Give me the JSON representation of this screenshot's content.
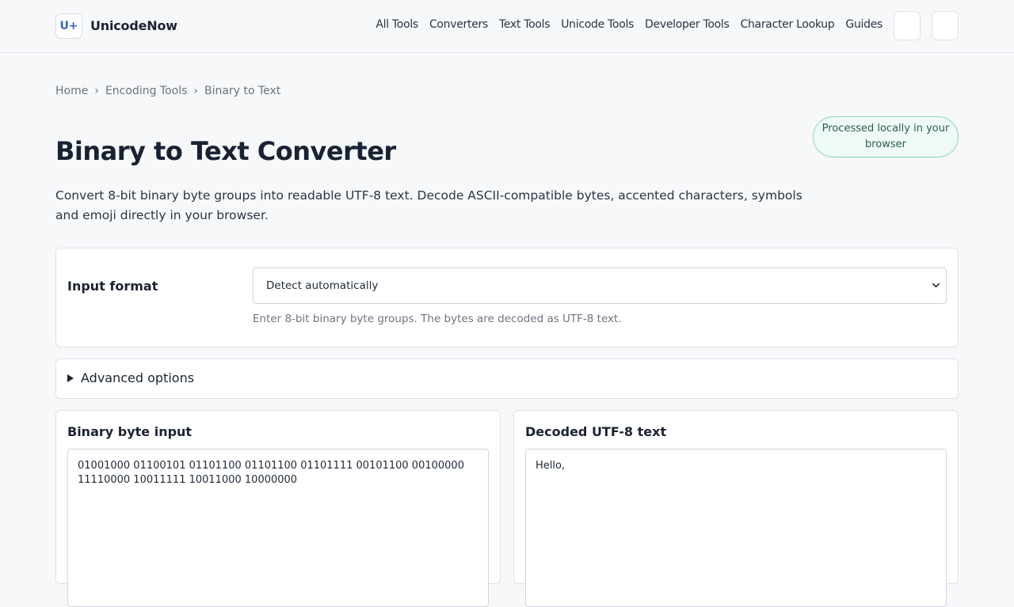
{
  "brand": {
    "logo": "U+",
    "name": "UnicodeNow"
  },
  "nav": {
    "items": [
      "All Tools",
      "Converters",
      "Text Tools",
      "Unicode Tools",
      "Developer Tools",
      "Character Lookup",
      "Guides"
    ]
  },
  "breadcrumb": {
    "home": "Home",
    "section": "Encoding Tools",
    "current": "Binary to Text",
    "separator": "›"
  },
  "badge": {
    "text": "Processed locally in your browser"
  },
  "page": {
    "title": "Binary to Text Converter",
    "description": "Convert 8-bit binary byte groups into readable UTF-8 text. Decode ASCII-compatible bytes, accented characters, symbols and emoji directly in your browser."
  },
  "format": {
    "label": "Input format",
    "selected": "Detect automatically",
    "hint": "Enter 8-bit binary byte groups. The bytes are decoded as UTF-8 text."
  },
  "advanced": {
    "label": "Advanced options"
  },
  "input_panel": {
    "title": "Binary byte input",
    "value": "01001000 01100101 01101100 01101100 01101111 00101100 00100000 11110000 10011111 10011000 10000000"
  },
  "output_panel": {
    "title": "Decoded UTF-8 text",
    "value": "Hello,"
  },
  "colors": {
    "accent": "#3763c9",
    "badge_bg": "#effaf6",
    "badge_border": "#8fd3bb",
    "page_bg": "#f6f8fa"
  }
}
